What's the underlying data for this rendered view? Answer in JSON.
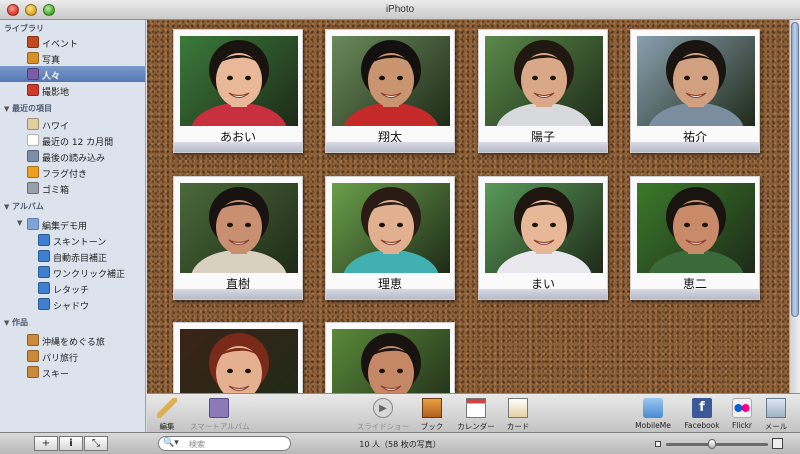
{
  "window": {
    "title": "iPhoto"
  },
  "sidebar": {
    "library_header": "ライブラリ",
    "library_items": [
      {
        "label": "イベント",
        "icon": "events-icon",
        "color": "#c04a1e"
      },
      {
        "label": "写真",
        "icon": "photos-icon",
        "color": "#d8902a"
      },
      {
        "label": "人々",
        "icon": "faces-icon",
        "color": "#7a5ca8",
        "selected": true
      },
      {
        "label": "撮影地",
        "icon": "places-icon",
        "color": "#d03a2c"
      }
    ],
    "recent_header": "最近の項目",
    "recent_items": [
      {
        "label": "ハワイ",
        "icon": "hawaii-album-icon",
        "color": "#e2cfa0"
      },
      {
        "label": "最近の 12 カ月間",
        "icon": "calendar-icon",
        "color": "#ffffff"
      },
      {
        "label": "最後の読み込み",
        "icon": "import-icon",
        "color": "#7f8ea8"
      },
      {
        "label": "フラグ付き",
        "icon": "flag-icon",
        "color": "#f0a020"
      },
      {
        "label": "ゴミ箱",
        "icon": "trash-icon",
        "color": "#9aa0a8"
      }
    ],
    "albums_header": "アルバム",
    "albums_folder": {
      "label": "編集デモ用",
      "icon": "folder-icon",
      "color": "#7fa4d6"
    },
    "albums_items": [
      {
        "label": "スキントーン",
        "icon": "smart-album-icon",
        "color": "#3f7fd0"
      },
      {
        "label": "自動赤目補正",
        "icon": "smart-album-icon",
        "color": "#3f7fd0"
      },
      {
        "label": "ワンクリック補正",
        "icon": "smart-album-icon",
        "color": "#3f7fd0"
      },
      {
        "label": "レタッチ",
        "icon": "smart-album-icon",
        "color": "#3f7fd0"
      },
      {
        "label": "シャドウ",
        "icon": "smart-album-icon",
        "color": "#3f7fd0"
      }
    ],
    "projects_header": "作品",
    "projects_items": [
      {
        "label": "沖縄をめぐる旅",
        "icon": "book-icon",
        "color": "#c98a3a"
      },
      {
        "label": "パリ旅行",
        "icon": "book-icon",
        "color": "#c98a3a"
      },
      {
        "label": "スキー",
        "icon": "book-icon",
        "color": "#c98a3a"
      }
    ]
  },
  "faces": [
    {
      "name": "あおい",
      "bg": "#3a7a3a",
      "skin": "#e8b898",
      "hair": "#1a1410",
      "shirt": "#c83040"
    },
    {
      "name": "翔太",
      "bg": "#6a8a5a",
      "skin": "#c99470",
      "hair": "#141010",
      "shirt": "#c42a2a"
    },
    {
      "name": "陽子",
      "bg": "#5a8a4a",
      "skin": "#d8a888",
      "hair": "#221812",
      "shirt": "#d7d9dc"
    },
    {
      "name": "祐介",
      "bg": "#8aa0b0",
      "skin": "#d0a080",
      "hair": "#1a1410",
      "shirt": "#7a8ea0"
    },
    {
      "name": "直樹",
      "bg": "#4a6a3a",
      "skin": "#c89070",
      "hair": "#181210",
      "shirt": "#d8d0c0"
    },
    {
      "name": "理恵",
      "bg": "#6aa04a",
      "skin": "#e0b090",
      "hair": "#2a1c14",
      "shirt": "#40b0b0"
    },
    {
      "name": "まい",
      "bg": "#5a9a5a",
      "skin": "#e6b898",
      "hair": "#201610",
      "shirt": "#e8e8ee"
    },
    {
      "name": "恵二",
      "bg": "#3a7a2a",
      "skin": "#c88a68",
      "hair": "#1a1410",
      "shirt": "#3a6a3a"
    },
    {
      "name": "",
      "bg": "#3a2418",
      "skin": "#e4b090",
      "hair": "#7a2a18",
      "shirt": "#6a3a2a"
    },
    {
      "name": "",
      "bg": "#5a8a3a",
      "skin": "#c48866",
      "hair": "#181210",
      "shirt": "#c03040"
    }
  ],
  "toolbar": {
    "left": [
      {
        "label": "編集",
        "icon": "pencil-icon",
        "dim": false
      },
      {
        "label": "スマートアルバム",
        "icon": "smart-album-add-icon",
        "dim": true
      }
    ],
    "center": [
      {
        "label": "スライドショー",
        "icon": "play-icon",
        "dim": true
      },
      {
        "label": "ブック",
        "icon": "book-icon",
        "dim": false
      },
      {
        "label": "カレンダー",
        "icon": "calendar-icon",
        "dim": false
      },
      {
        "label": "カード",
        "icon": "card-icon",
        "dim": false
      }
    ],
    "right": [
      {
        "label": "MobileMe",
        "icon": "mobileme-icon",
        "dim": false
      },
      {
        "label": "Facebook",
        "icon": "facebook-icon",
        "dim": false
      },
      {
        "label": "Flickr",
        "icon": "flickr-icon",
        "dim": false
      },
      {
        "label": "メール",
        "icon": "mail-icon",
        "dim": false
      }
    ]
  },
  "statusbar": {
    "add_label": "+",
    "info_label": "i",
    "fullscreen_label": "⤡",
    "search_placeholder": "検索",
    "count_text": "10 人（58 枚の写真）",
    "zoom_level": 0.45
  }
}
